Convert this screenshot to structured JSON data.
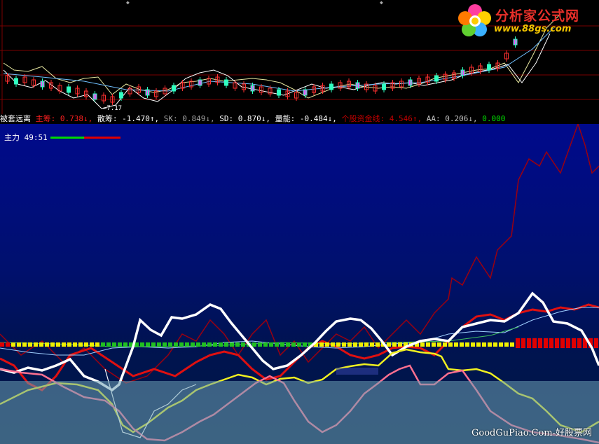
{
  "logo": {
    "title": "分析家公式网",
    "url": "www.88gs.com"
  },
  "top_panel": {
    "low_price_label": "←7.17"
  },
  "indicator_bar": {
    "name": "被套远离",
    "items": [
      {
        "label": "主筹:",
        "value": "0.738",
        "arrow": "↓",
        "color": "#ff2020"
      },
      {
        "label": "散筹:",
        "value": "-1.470",
        "arrow": "↑",
        "color": "#ffffff"
      },
      {
        "label": "SK:",
        "value": "0.849",
        "arrow": "↓",
        "color": "#a0a0a0"
      },
      {
        "label": "SD:",
        "value": "0.870",
        "arrow": "↓",
        "color": "#ffffff"
      },
      {
        "label": "量能:",
        "value": "-0.484",
        "arrow": "↓",
        "color": "#ffffff"
      },
      {
        "label": "个股资金线:",
        "value": "4.546",
        "arrow": "↑",
        "color": "#c00000"
      },
      {
        "label": "AA:",
        "value": "0.206",
        "arrow": "↓",
        "color": "#c0c0c0"
      },
      {
        "label": "",
        "value": "0.000",
        "arrow": "",
        "color": "#00e000"
      }
    ]
  },
  "indicator_label": "主力 49:51",
  "watermark": "GoodGuPiao.Com-好股票网",
  "colors": {
    "up": "#ff3030",
    "down": "#30ffc0",
    "bg_top": "#000000",
    "bg_bottom": "#000a8c"
  }
}
